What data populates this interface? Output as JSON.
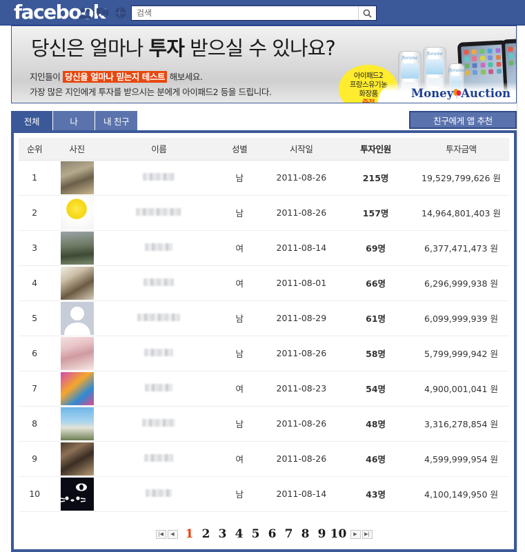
{
  "fbbar": {
    "logo": "facebook",
    "icons": [
      {
        "name": "friend-requests-icon",
        "label": "friend requests"
      },
      {
        "name": "messages-icon",
        "label": "messages"
      },
      {
        "name": "notifications-icon",
        "label": "notifications"
      }
    ],
    "search_placeholder": "검색",
    "search_value": "",
    "search_button": "search-icon",
    "bg_color": "#3b5998"
  },
  "banner": {
    "headline_pre": "당신은 얼마나 ",
    "headline_bold": "투자",
    "headline_post": " 받으실 수 있나요?",
    "line1_pre": "지인들이 ",
    "line1_highlight": "당신을 얼마나 믿는지 테스트",
    "line1_post": " 해보세요.",
    "line2": "가장 많은 지인에게 투자를 받으시는 분에게 아이패드2 등을 드립니다.",
    "bubble_line1": "아이패드2",
    "bubble_line2": "프랑스유기농",
    "bubble_line3": "화장품",
    "bubble_line4": "증정",
    "bubble_color": "#ffec2e",
    "highlight_color": "#e8470e",
    "brand_money": "Money",
    "brand_auction": "Auction",
    "product_brand": "florame"
  },
  "tabs": [
    {
      "label": "전체",
      "active": true
    },
    {
      "label": "나",
      "active": false
    },
    {
      "label": "내 친구",
      "active": false
    }
  ],
  "recommend_button": "친구에게 앱 추천",
  "table": {
    "columns": [
      "순위",
      "사진",
      "이름",
      "성별",
      "시작일",
      "투자인원",
      "투자금액"
    ],
    "rows": [
      {
        "rank": "1",
        "name_redacted": true,
        "name_width": 46,
        "sex": "남",
        "date": "2011-08-26",
        "count": "215명",
        "amount": "19,529,799,626 원",
        "avatar": "child-with-pots"
      },
      {
        "rank": "2",
        "name_redacted": true,
        "name_width": 66,
        "sex": "남",
        "date": "2011-08-26",
        "count": "157명",
        "amount": "14,964,801,403 원",
        "avatar": "yellow-smiley"
      },
      {
        "rank": "3",
        "name_redacted": true,
        "name_width": 40,
        "sex": "여",
        "date": "2011-08-14",
        "count": "69명",
        "amount": "6,377,471,473 원",
        "avatar": "person-outdoors"
      },
      {
        "rank": "4",
        "name_redacted": true,
        "name_width": 44,
        "sex": "여",
        "date": "2011-08-01",
        "count": "66명",
        "amount": "6,296,999,938 원",
        "avatar": "dog"
      },
      {
        "rank": "5",
        "name_redacted": true,
        "name_width": 62,
        "sex": "남",
        "date": "2011-08-29",
        "count": "61명",
        "amount": "6,099,999,939 원",
        "avatar": "default-silhouette"
      },
      {
        "rank": "6",
        "name_redacted": true,
        "name_width": 42,
        "sex": "남",
        "date": "2011-08-26",
        "count": "58명",
        "amount": "5,799,999,942 원",
        "avatar": "baby"
      },
      {
        "rank": "7",
        "name_redacted": true,
        "name_width": 40,
        "sex": "여",
        "date": "2011-08-23",
        "count": "54명",
        "amount": "4,900,001,041 원",
        "avatar": "cartoon-girl"
      },
      {
        "rank": "8",
        "name_redacted": true,
        "name_width": 48,
        "sex": "남",
        "date": "2011-08-26",
        "count": "48명",
        "amount": "3,316,278,854 원",
        "avatar": "child-on-beach"
      },
      {
        "rank": "9",
        "name_redacted": true,
        "name_width": 42,
        "sex": "여",
        "date": "2011-08-26",
        "count": "46명",
        "amount": "4,599,999,954 원",
        "avatar": "two-people-sunglasses"
      },
      {
        "rank": "10",
        "name_redacted": true,
        "name_width": 38,
        "sex": "남",
        "date": "2011-08-14",
        "count": "43명",
        "amount": "4,100,149,950 원",
        "avatar": "hello-kitty"
      }
    ]
  },
  "pagination": {
    "first": "|◀",
    "prev": "◀",
    "pages": [
      "1",
      "2",
      "3",
      "4",
      "5",
      "6",
      "7",
      "8",
      "9",
      "10"
    ],
    "current": "1",
    "next": "▶",
    "last": "▶|",
    "current_color": "#ef3d0a"
  }
}
